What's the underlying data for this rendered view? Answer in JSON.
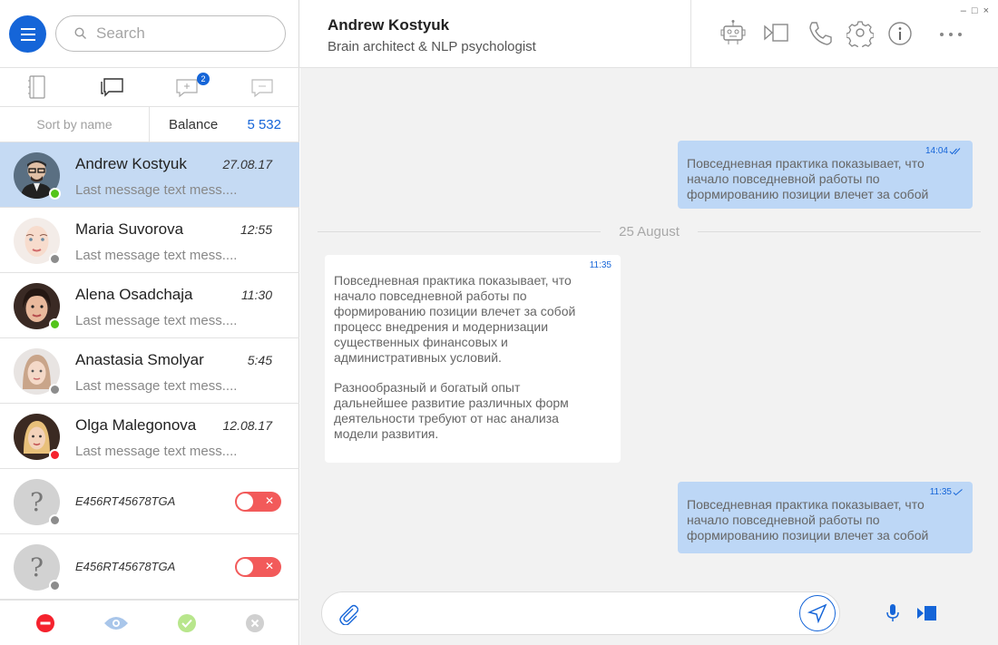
{
  "search": {
    "placeholder": "Search"
  },
  "tabs": [
    {
      "icon": "book-icon"
    },
    {
      "icon": "chats-icon"
    },
    {
      "icon": "new-chat-icon",
      "badge": "2"
    },
    {
      "icon": "message-icon"
    }
  ],
  "sort": {
    "label": "Sort by name",
    "balance_label": "Balance",
    "balance_value": "5 532"
  },
  "contacts": [
    {
      "name": "Andrew Kostyuk",
      "time": "27.08.17",
      "message": "Last message text mess....",
      "status": "online"
    },
    {
      "name": "Maria Suvorova",
      "time": "12:55",
      "message": "Last message text mess....",
      "status": "offline"
    },
    {
      "name": "Alena Osadchaja",
      "time": "11:30",
      "message": "Last message text mess....",
      "status": "online"
    },
    {
      "name": "Anastasia Smolyar",
      "time": "5:45",
      "message": "Last message text mess....",
      "status": "offline"
    },
    {
      "name": "Olga Malegonova",
      "time": "12.08.17",
      "message": "Last message text mess....",
      "status": "busy"
    },
    {
      "id": "E456RT45678TGA",
      "avatar": "?",
      "status": "offline"
    },
    {
      "id": "E456RT45678TGA",
      "avatar": "?",
      "status": "offline"
    }
  ],
  "colors": {
    "accent": "#1565d8",
    "online": "#52c41a",
    "offline": "#8c8c8c",
    "busy": "#f5222d",
    "outgoing": "#bdd7f6"
  },
  "chat": {
    "name": "Andrew Kostyuk",
    "status": "Brain architect & NLP psychologist",
    "date_divider": "25 August",
    "messages": [
      {
        "dir": "out",
        "time": "14:04",
        "text": "Повседневная практика показывает, что\nначало повседневной работы по\nформированию позиции влечет за собой"
      },
      {
        "dir": "in",
        "time": "11:35",
        "text": "Повседневная практика показывает, что\nначало повседневной работы по\nформированию позиции влечет за собой\nпроцесс внедрения и модернизации\nсущественных финансовых и\nадминистративных условий.",
        "text2": "Разнообразный и богатый опыт\nдальнейшее развитие различных форм\nдеятельности требуют от нас анализа\nмодели развития."
      },
      {
        "dir": "out",
        "time": "11:35",
        "text": "Повседневная практика показывает, что\nначало повседневной работы по\nформированию позиции влечет за собой"
      }
    ]
  },
  "window_controls": [
    "–",
    "□",
    "×"
  ]
}
